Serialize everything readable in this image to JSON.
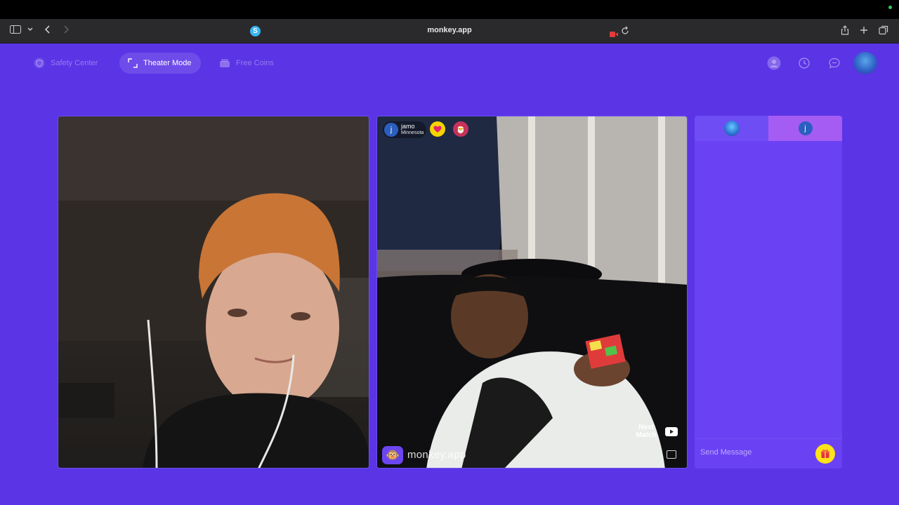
{
  "browser": {
    "url": "monkey.app",
    "site_badge": "S"
  },
  "nav": {
    "safety_center": "Safety Center",
    "theater_mode": "Theater Mode",
    "free_coins": "Free Coins"
  },
  "match": {
    "user_initial": "j",
    "user_name": "jamo",
    "user_location": "Minnesota",
    "next_match": "Next Match",
    "brand": "monkey.app",
    "brand_emoji": "🐵",
    "gift_emoji": "🎅"
  },
  "chat": {
    "tab_user_initial": "j",
    "placeholder": "Send Message"
  },
  "colors": {
    "background": "#5b34e6",
    "chat_panel": "#6a42f3",
    "gift_button": "#ffe21a",
    "heart_badge": "#f5d400"
  }
}
